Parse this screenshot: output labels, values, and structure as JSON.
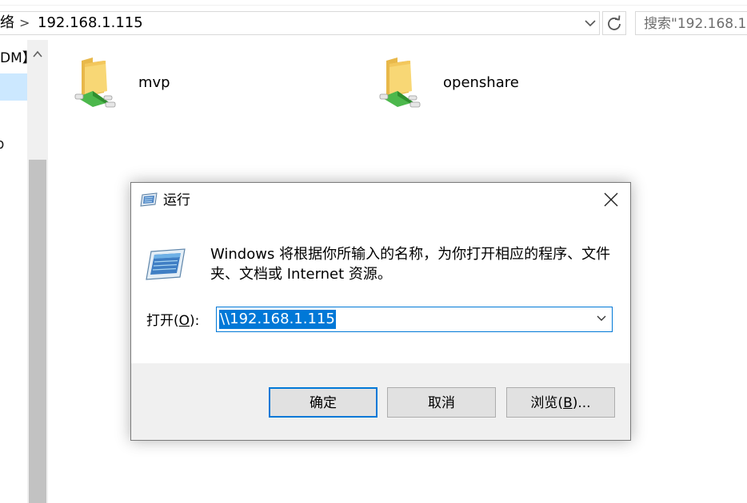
{
  "explorer": {
    "address": {
      "prefix": "络",
      "separator": ">",
      "path": "192.168.1.115"
    },
    "search": {
      "placeholder": "搜索\"192.168.1"
    },
    "nav": {
      "item_partial": "DM】",
      "item_partial_2": "p"
    },
    "shares": [
      {
        "name": "mvp"
      },
      {
        "name": "openshare"
      }
    ]
  },
  "run_dialog": {
    "title": "运行",
    "description": "Windows 将根据你所输入的名称，为你打开相应的程序、文件夹、文档或 Internet 资源。",
    "open_label_prefix": "打开(",
    "open_label_mnemonic": "O",
    "open_label_suffix": "):",
    "input_value": "\\\\192.168.1.115",
    "buttons": {
      "ok": "确定",
      "cancel": "取消",
      "browse_prefix": "浏览(",
      "browse_mnemonic": "B",
      "browse_suffix": ")..."
    }
  },
  "colors": {
    "accent": "#0078d7",
    "nav_selected": "#cce8ff",
    "footer": "#f0f0f0",
    "button": "#e1e1e1"
  }
}
